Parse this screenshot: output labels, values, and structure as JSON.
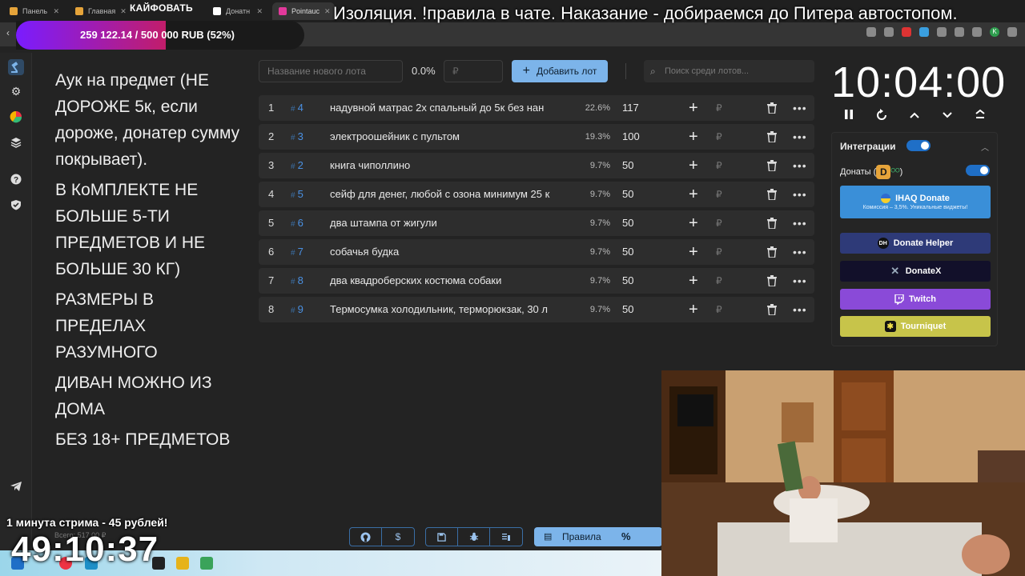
{
  "browser": {
    "tabs": [
      {
        "label": "Панель",
        "color": "#e6a43a"
      },
      {
        "label": "Главная",
        "color": "#e6a43a"
      },
      {
        "label": "Донатн",
        "color": "#ffffff"
      },
      {
        "label": "Pointauc",
        "color": "#e2399b"
      }
    ]
  },
  "overlay": {
    "title": "Изоляция. !правила в чате. Наказание - добираемся до Питера автостопом.",
    "kaif": "КАЙФОВАТЬ",
    "goal_text": "259 122.14 / 500 000 RUB (52%)",
    "goal_progress": 0.52,
    "stream_note": "1 минута стрима - 45 рублей!",
    "big_timer": "49:10:37",
    "vsego": "Всего: 517.00 ₽"
  },
  "rules": [
    "Аук на предмет (НЕ ДОРОЖЕ 5к, если дороже, донатер сумму покрывает).",
    "В КоМПЛЕКТЕ НЕ БОЛЬШЕ 5-ТИ ПРЕДМЕТОВ И НЕ БОЛЬШЕ 30 КГ)",
    "РАЗМЕРЫ В ПРЕДЕЛАХ РАЗУМНОГО",
    "ДИВАН МОЖНО ИЗ ДОМА",
    "БЕЗ 18+ ПРЕДМЕТОВ"
  ],
  "controls": {
    "new_lot_placeholder": "Название нового лота",
    "percent": "0.0%",
    "rub_placeholder": "₽",
    "add_lot_label": "Добавить лот",
    "search_placeholder": "Поиск среди лотов..."
  },
  "lots": [
    {
      "num": "1",
      "id": "4",
      "name": "надувной матрас 2х спальный до 5к без нан",
      "percent": "22.6%",
      "amount": "117"
    },
    {
      "num": "2",
      "id": "3",
      "name": "электроошейник с пультом",
      "percent": "19.3%",
      "amount": "100"
    },
    {
      "num": "3",
      "id": "2",
      "name": "книга чиполлино",
      "percent": "9.7%",
      "amount": "50"
    },
    {
      "num": "4",
      "id": "5",
      "name": "сейф для денег, любой с озона минимум 25 к",
      "percent": "9.7%",
      "amount": "50"
    },
    {
      "num": "5",
      "id": "6",
      "name": "два штампа от жигули",
      "percent": "9.7%",
      "amount": "50"
    },
    {
      "num": "6",
      "id": "7",
      "name": "собачья будка",
      "percent": "9.7%",
      "amount": "50"
    },
    {
      "num": "7",
      "id": "8",
      "name": "два квадроберских костюма собаки",
      "percent": "9.7%",
      "amount": "50"
    },
    {
      "num": "8",
      "id": "9",
      "name": "Термосумка холодильник, терморюкзак, 30 л",
      "percent": "9.7%",
      "amount": "50"
    }
  ],
  "timer": {
    "value": "10:04:00"
  },
  "integrations": {
    "title": "Интеграции",
    "donats_label": "Донаты (",
    "donats_close": ")",
    "donats_badge": "D",
    "donats_oo": "ᴼᴼ",
    "ihaq": {
      "label": "IHAQ Donate",
      "sub": "Комиссия – 3,5%. Уникальные виджеты!",
      "color": "#3a8fd8"
    },
    "services": [
      {
        "label": "Donate Helper",
        "color": "#2e3a78",
        "icon": "DH"
      },
      {
        "label": "DonateX",
        "color": "#12102a",
        "icon": "X"
      },
      {
        "label": "Twitch",
        "color": "#8a4ad8",
        "icon": "T"
      },
      {
        "label": "Tourniquet",
        "color": "#c7c44a",
        "icon": "✱"
      }
    ]
  },
  "bottom": {
    "rules_label": "Правила",
    "percent_symbol": "%"
  }
}
